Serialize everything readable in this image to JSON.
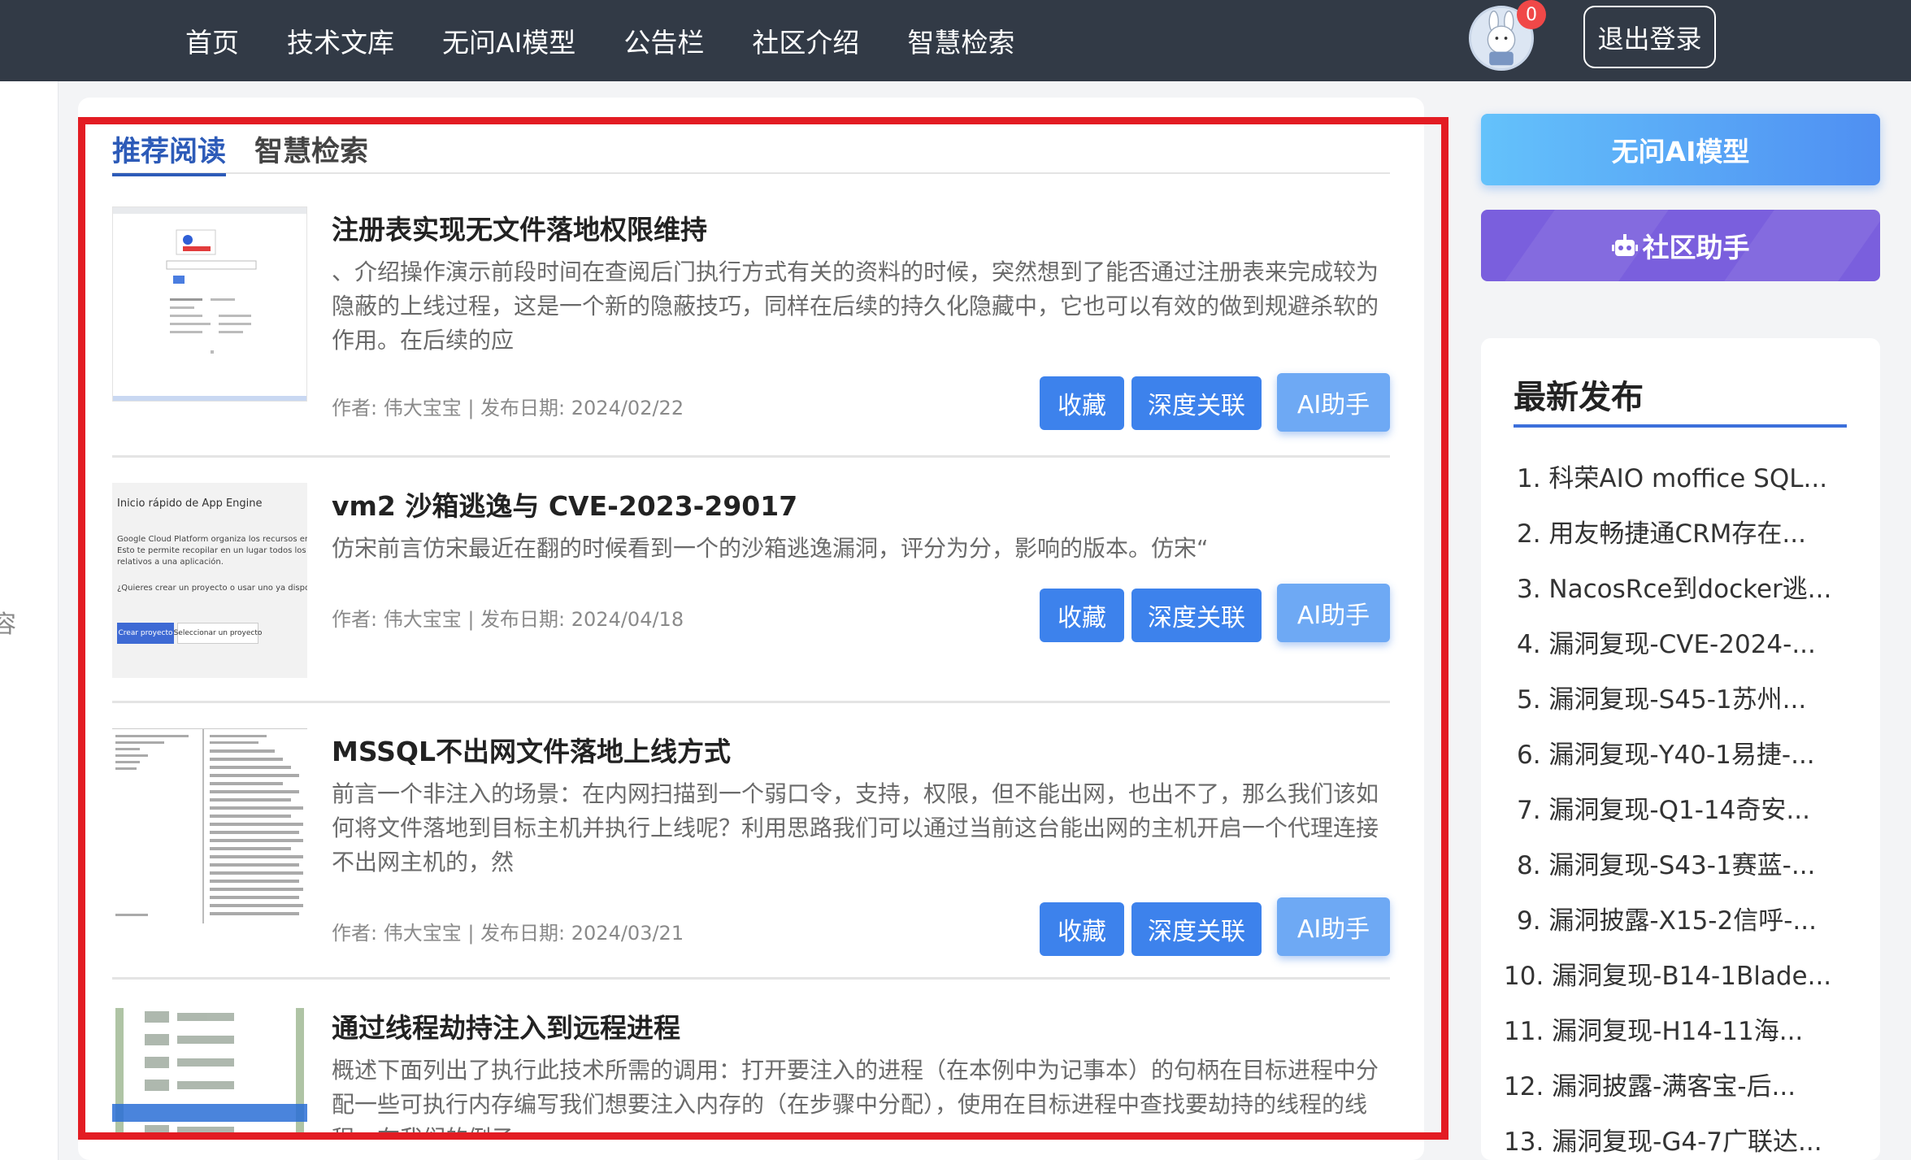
{
  "nav": {
    "items": [
      "首页",
      "技术文库",
      "无问AI模型",
      "公告栏",
      "社区介绍",
      "智慧检索"
    ],
    "notification_count": "0",
    "logout_label": "退出登录"
  },
  "left_partial_char": "容",
  "tabs": [
    "推荐阅读",
    "智慧检索"
  ],
  "buttons": {
    "favorite": "收藏",
    "deep_link": "深度关联",
    "ai_helper": "AI助手"
  },
  "articles": [
    {
      "title": "注册表实现无文件落地权限维持",
      "summary": "、介绍操作演示前段时间在查阅后门执行方式有关的资料的时候，突然想到了能否通过注册表来完成较为隐蔽的上线过程，这是一个新的隐蔽技巧，同样在后续的持久化隐藏中，它也可以有效的做到规避杀软的作用。在后续的应",
      "meta": "作者: 伟大宝宝 | 发布日期: 2024/02/22"
    },
    {
      "title": "vm2 沙箱逃逸与 CVE-2023-29017",
      "summary": "仿宋前言仿宋最近在翻的时候看到一个的沙箱逃逸漏洞，评分为分，影响的版本。仿宋“",
      "meta": "作者: 伟大宝宝 | 发布日期: 2024/04/18",
      "thumb_text": {
        "heading": "Inicio rápido de App Engine",
        "line1": "Google Cloud Platform organiza los recursos en proyectos.",
        "line2": "Esto te permite recopilar en un lugar todos los recursos",
        "line3": "relativos a una aplicación.",
        "question": "¿Quieres crear un proyecto o usar uno ya disponible?",
        "btn_create": "Crear proyecto",
        "btn_select": "Seleccionar un proyecto"
      }
    },
    {
      "title": "MSSQL不出网文件落地上线方式",
      "summary": "前言一个非注入的场景：在内网扫描到一个弱口令，支持，权限，但不能出网，也出不了，那么我们该如何将文件落地到目标主机并执行上线呢？利用思路我们可以通过当前这台能出网的主机开启一个代理连接不出网主机的，然",
      "meta": "作者: 伟大宝宝 | 发布日期: 2024/03/21"
    },
    {
      "title": "通过线程劫持注入到远程进程",
      "summary": "概述下面列出了执行此技术所需的调用：打开要注入的进程（在本例中为记事本）的句柄在目标进程中分配一些可执行内存编写我们想要注入内存的（在步骤中分配），使用在目标进程中查找要劫持的线程的线程。在我们的例子"
    }
  ],
  "sidebar": {
    "ai_model_label": "无问AI模型",
    "helper_label": "社区助手",
    "latest_title": "最新发布",
    "latest_items": [
      "1. 科荣AIO moffice SQL...",
      "2. 用友畅捷通CRM存在...",
      "3. NacosRce到docker逃...",
      "4. 漏洞复现-CVE-2024-...",
      "5. 漏洞复现-S45-1苏州...",
      "6. 漏洞复现-Y40-1易捷-...",
      "7. 漏洞复现-Q1-14奇安...",
      "8. 漏洞复现-S43-1赛蓝-...",
      "9. 漏洞披露-X15-2信呼-...",
      "10. 漏洞复现-B14-1Blade...",
      "11. 漏洞复现-H14-11海...",
      "12. 漏洞披露-满客宝-后...",
      "13. 漏洞复现-G4-7广联达..."
    ]
  }
}
